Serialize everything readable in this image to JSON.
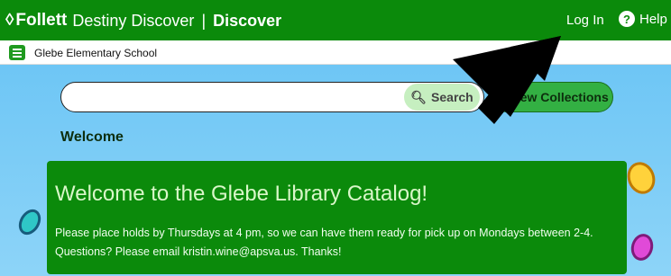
{
  "header": {
    "logo_mark": "◊",
    "logo_word": "Follett",
    "product": "Destiny Discover",
    "separator": "|",
    "app_name": "Discover",
    "login_label": "Log In",
    "help_label": "Help",
    "help_icon": "?"
  },
  "school_bar": {
    "school_name": "Glebe Elementary School"
  },
  "search": {
    "value": "",
    "placeholder": "",
    "button_label": "Search",
    "search_icon": "🔍︎"
  },
  "collections": {
    "button_label": "View Collections"
  },
  "welcome": {
    "heading": "Welcome",
    "card_title": "Welcome to the Glebe Library Catalog!",
    "card_line1": "Please place holds by Thursdays at 4 pm, so we can have them ready for pick up on Mondays between 2-4.",
    "card_line2": "Questions? Please email kristin.wine@apsva.us. Thanks!"
  },
  "colors": {
    "header_bg": "#0b8a0b",
    "card_bg": "#0b8a0b",
    "main_bg": "#6ec6f5",
    "accent_button": "#33b043"
  }
}
